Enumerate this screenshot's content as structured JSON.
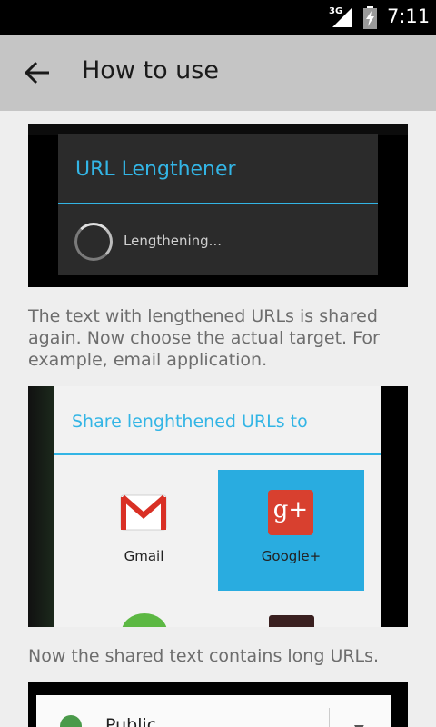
{
  "status_bar": {
    "network": "3G",
    "time": "7:11"
  },
  "action_bar": {
    "title": "How to use"
  },
  "shot1": {
    "dialog_title": "URL Lengthener",
    "message": "Lengthening..."
  },
  "caption1": "The text with lengthened URLs is shared again. Now choose the actual target. For example, email application.",
  "shot2": {
    "dialog_title": "Share lenghthened URLs to",
    "items": [
      {
        "label": "Gmail"
      },
      {
        "label": "Google+"
      }
    ]
  },
  "caption2": "Now the shared text contains long URLs.",
  "shot3": {
    "visibility_label": "Public"
  },
  "colors": {
    "accent": "#33b5e5",
    "selected": "#29ace0",
    "action_bar": "#c5c5c5",
    "background": "#eeeeee"
  }
}
